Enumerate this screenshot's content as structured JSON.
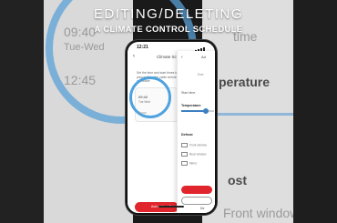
{
  "overlay": {
    "title": "EDITING/DELETING",
    "subtitle": "A CLIMATE CONTROL SCHEDULE"
  },
  "background": {
    "time": "09:40",
    "days": "Tue-Wed",
    "time2": "12:45",
    "start_time_fragment": "time",
    "temperature_fragment": "perature",
    "defrost_fragment": "ost",
    "front_window_fragment": "Front window"
  },
  "status_bar": {
    "time": "12:21"
  },
  "schedule_list": {
    "title": "Climate Sche",
    "description": "Set the time and start times to precondition the cabin before you leave.",
    "entry": {
      "time": "09:40",
      "days": "Tue-Wed",
      "status": "Pause"
    },
    "add_button": "Add a New Sche"
  },
  "schedule_edit": {
    "title": "Ad",
    "subtitle": "Ener",
    "start_time_label": "Start time",
    "temperature_label": "Temperature",
    "temperature_level": 0.75,
    "defrost_label": "Defrost",
    "options": [
      "Front window",
      "Rear window",
      "Mirror"
    ],
    "save_button": "Sa",
    "delete_button": "De"
  },
  "colors": {
    "accent_red": "#e0262c",
    "accent_blue": "#4ea3df"
  }
}
